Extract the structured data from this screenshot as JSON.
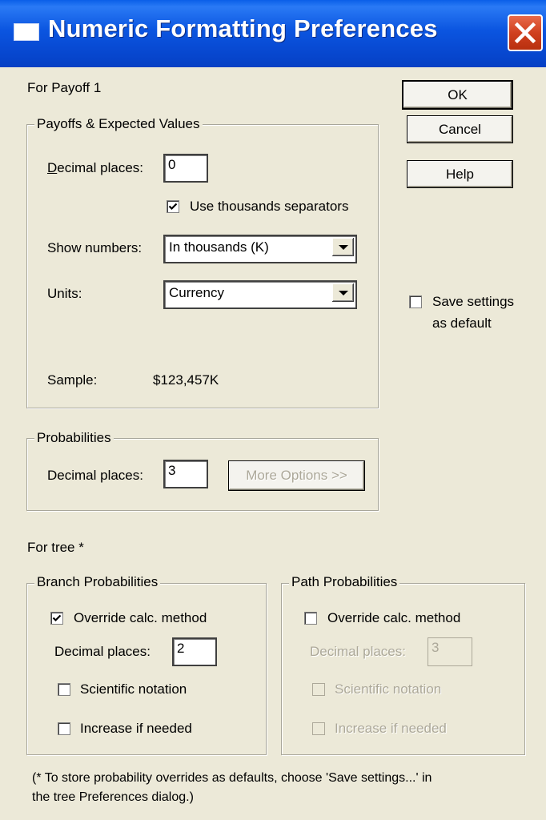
{
  "window": {
    "title": "Numeric Formatting Preferences"
  },
  "payoff": {
    "heading": "For Payoff 1",
    "group_title": "Payoffs & Expected Values",
    "decimal_places_label": "Decimal places:",
    "decimal_places_value": "0",
    "use_thousands_label": "Use thousands separators",
    "use_thousands_checked": true,
    "show_numbers_label": "Show numbers:",
    "show_numbers_value": "In thousands (K)",
    "units_label": "Units:",
    "units_value": "Currency",
    "sample_label": "Sample:",
    "sample_value": "$123,457K"
  },
  "probabilities": {
    "group_title": "Probabilities",
    "decimal_places_label": "Decimal places:",
    "decimal_places_value": "3",
    "more_options_label": "More Options >>"
  },
  "buttons": {
    "ok": "OK",
    "cancel": "Cancel",
    "help": "Help"
  },
  "save_settings": {
    "label_line1": "Save settings",
    "label_line2": "as default",
    "checked": false
  },
  "tree": {
    "heading": "For tree *",
    "branch": {
      "group_title": "Branch Probabilities",
      "override_label": "Override calc. method",
      "override_checked": true,
      "decimal_places_label": "Decimal places:",
      "decimal_places_value": "2",
      "scientific_label": "Scientific notation",
      "increase_label": "Increase if needed"
    },
    "path": {
      "group_title": "Path Probabilities",
      "override_label": "Override calc. method",
      "override_checked": false,
      "decimal_places_label": "Decimal places:",
      "decimal_places_value": "3",
      "scientific_label": "Scientific notation",
      "increase_label": "Increase if needed"
    }
  },
  "footnote": {
    "line1": "(* To store probability overrides as defaults, choose 'Save settings...' in",
    "line2": "the tree Preferences dialog.)"
  },
  "colors": {
    "titlebar": "#0a5fe8",
    "dialog_bg": "#ece9d8",
    "close_button": "#d0401f"
  }
}
